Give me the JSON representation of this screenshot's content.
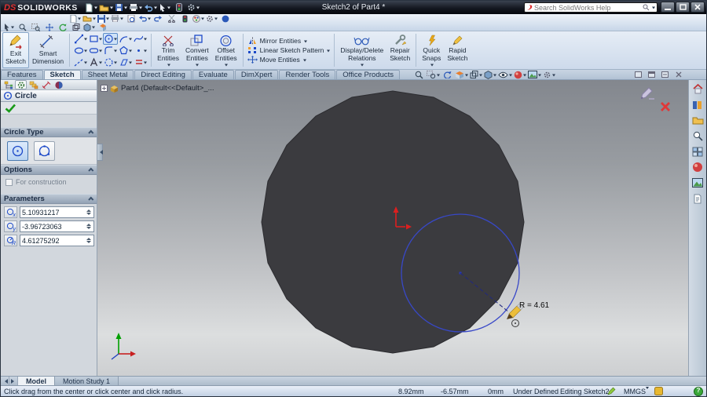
{
  "colors": {
    "brand_red": "#e03030",
    "selection_blue": "#2a48c8",
    "sketch_blue": "#3848c8",
    "polygon_gray": "#3b3b3f",
    "viewport_top": "#83878e",
    "viewport_bottom": "#cdcfd1",
    "status_ok_green": "#1a9a1a"
  },
  "icons": {
    "help": "?",
    "param_x": "x",
    "param_y": "y",
    "param_r": "R"
  },
  "titlebar": {
    "logo_ds": "DS",
    "logo_text": "SOLIDWORKS",
    "title": "Sketch2 of Part4 *",
    "search_placeholder": "Search SolidWorks Help"
  },
  "ribbon": {
    "exit_sketch": "Exit\nSketch",
    "smart_dimension": "Smart\nDimension",
    "trim_entities": "Trim\nEntities",
    "convert_entities": "Convert\nEntities",
    "offset_entities": "Offset\nEntities",
    "mirror_entities": "Mirror Entities",
    "linear_pattern": "Linear Sketch Pattern",
    "move_entities": "Move Entities",
    "display_delete": "Display/Delete\nRelations",
    "repair_sketch": "Repair\nSketch",
    "quick_snaps": "Quick\nSnaps",
    "rapid_sketch": "Rapid\nSketch"
  },
  "tabs": {
    "items": [
      "Features",
      "Sketch",
      "Sheet Metal",
      "Direct Editing",
      "Evaluate",
      "DimXpert",
      "Render Tools",
      "Office Products"
    ],
    "active": "Sketch"
  },
  "panel": {
    "title": "Circle",
    "sections": {
      "circle_type": "Circle Type",
      "options": "Options",
      "for_construction": "For construction",
      "parameters": "Parameters"
    },
    "params": {
      "center_x": "5.10931217",
      "center_y": "-3.96723063",
      "radius": "4.61275292"
    }
  },
  "viewport": {
    "tree_root": "Part4 (Default<<Default>_...",
    "radius_label": "R = 4.61"
  },
  "bottom_tabs": {
    "model": "Model",
    "motion": "Motion Study 1"
  },
  "statusbar": {
    "hint": "Click drag from the center or click center and click radius.",
    "coord_x": "8.92mm",
    "coord_y": "-6.57mm",
    "coord_z": "0mm",
    "state": "Under Defined",
    "editing": "Editing Sketch2",
    "units": "MMGS"
  }
}
